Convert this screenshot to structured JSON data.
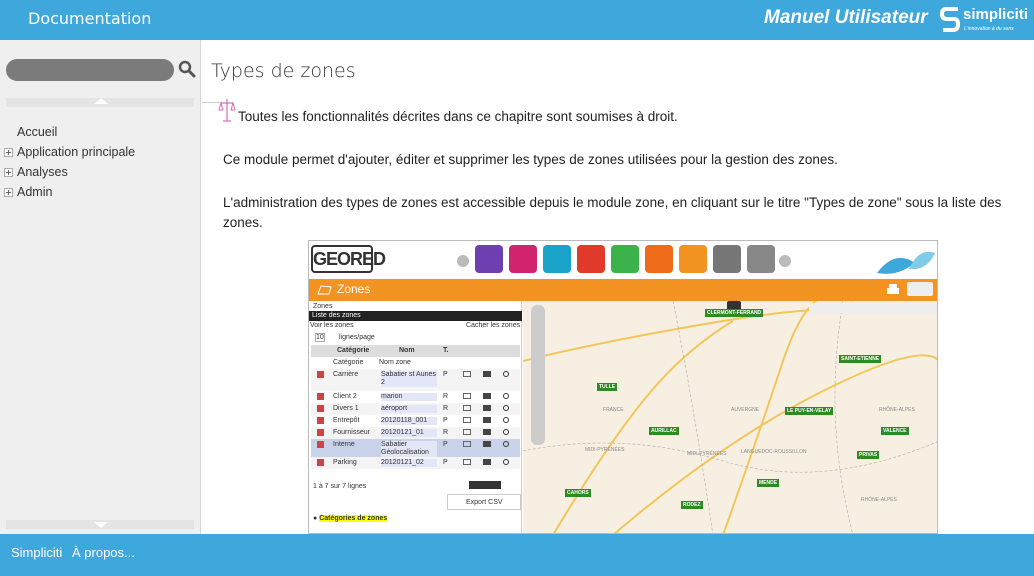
{
  "topbar": {
    "title": "Documentation",
    "manual_label": "Manuel Utilisateur",
    "brand": "simpliciti",
    "brand_tagline": "L'innovation à du sens"
  },
  "sidebar": {
    "search_placeholder": "",
    "items": [
      {
        "label": "Accueil",
        "expandable": false
      },
      {
        "label": "Application principale",
        "expandable": true
      },
      {
        "label": "Analyses",
        "expandable": true
      },
      {
        "label": "Admin",
        "expandable": true
      }
    ]
  },
  "content": {
    "title": "Types de zones",
    "paragraphs": [
      "Toutes les fonctionnalités décrites dans ce chapitre sont soumises à droit.",
      "Ce module permet d'ajouter, éditer et supprimer les types de zones utilisées pour la gestion des zones.",
      "L'administration des types de zones est accessible depuis le module zone, en cliquant sur le titre \"Types de zone\" sous la liste des zones."
    ]
  },
  "screenshot": {
    "logo": "GEORED",
    "module_title": "Zones",
    "panel": {
      "section": "Zones",
      "list_title": "Liste des zones",
      "show_label": "Voir les zones",
      "hide_label": "Cacher les zones",
      "per_page_value": "10",
      "per_page_label": "lignes/page",
      "headers": [
        "Catégorie",
        "Nom",
        "T."
      ],
      "filter_placeholders": [
        "Catégorie",
        "Nom zone"
      ],
      "rows": [
        {
          "cat": "Carrière",
          "name": "Sabatier st Aunes 2",
          "type": "P"
        },
        {
          "cat": "Client 2",
          "name": "marion",
          "type": "R"
        },
        {
          "cat": "Divers 1",
          "name": "aéroport",
          "type": "R"
        },
        {
          "cat": "Entrepôt",
          "name": "20120118_001",
          "type": "P"
        },
        {
          "cat": "Fournisseur",
          "name": "20120121_01",
          "type": "R"
        },
        {
          "cat": "Interne",
          "name": "Sabatier Géolocalisation",
          "type": "P"
        },
        {
          "cat": "Parking",
          "name": "20120121_02",
          "type": "P"
        }
      ],
      "count_text": "1 à 7 sur 7 lignes",
      "export_label": "Export CSV",
      "categories_label": "Catégories de zones"
    },
    "map": {
      "pins": [
        "CLERMONT-FERRAND",
        "SAINT-ETIENNE",
        "TULLE",
        "LE PUY-EN-VELAY",
        "AURILLAC",
        "VALENCE",
        "PRIVAS",
        "MENDE",
        "CAHORS",
        "RODEZ"
      ],
      "regions": [
        "FRANCE",
        "AUVERGNE",
        "RHÔNE-ALPES",
        "MIDI-PYRÉNÉES",
        "MIDI-PYRÉNÉES",
        "LANGUEDOC-ROUSSILLON",
        "RHÔNE-ALPES"
      ]
    }
  },
  "bottombar": {
    "link1": "Simpliciti",
    "link2": "À propos..."
  },
  "colors": {
    "primary": "#3ea8dc",
    "sidebar_bg": "#efefef",
    "module_orange": "#f39322",
    "pin_green": "#2e8b22"
  }
}
